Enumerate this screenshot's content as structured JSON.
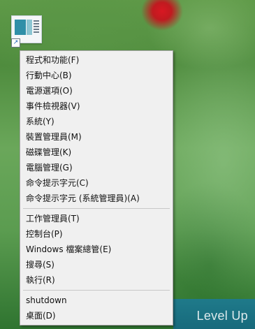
{
  "desktop": {
    "watermark": "Level Up"
  },
  "context_menu": {
    "groups": [
      [
        {
          "label": "程式和功能(F)"
        },
        {
          "label": "行動中心(B)"
        },
        {
          "label": "電源選項(O)"
        },
        {
          "label": "事件檢視器(V)"
        },
        {
          "label": "系統(Y)"
        },
        {
          "label": "裝置管理員(M)"
        },
        {
          "label": "磁碟管理(K)"
        },
        {
          "label": "電腦管理(G)"
        },
        {
          "label": "命令提示字元(C)"
        },
        {
          "label": "命令提示字元 (系統管理員)(A)"
        }
      ],
      [
        {
          "label": "工作管理員(T)"
        },
        {
          "label": "控制台(P)"
        },
        {
          "label": "Windows 檔案總管(E)"
        },
        {
          "label": "搜尋(S)"
        },
        {
          "label": "執行(R)"
        }
      ],
      [
        {
          "label": "shutdown"
        },
        {
          "label": "桌面(D)"
        }
      ]
    ]
  }
}
